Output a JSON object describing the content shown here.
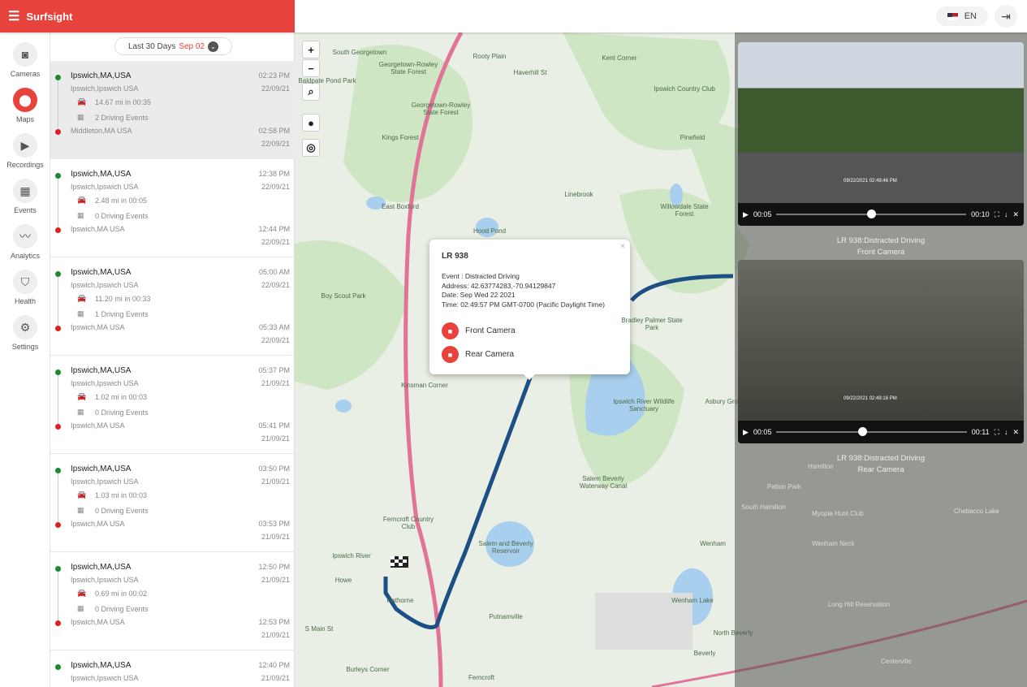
{
  "app": {
    "title": "Surfsight",
    "menu_icon": "menu-icon",
    "language": "EN",
    "logout_icon": "logout-icon"
  },
  "nav": [
    {
      "label": "Cameras",
      "icon": "camera-icon"
    },
    {
      "label": "Maps",
      "icon": "map-pin-icon",
      "active": true
    },
    {
      "label": "Recordings",
      "icon": "video-icon"
    },
    {
      "label": "Events",
      "icon": "calendar-icon"
    },
    {
      "label": "Analytics",
      "icon": "chart-line-icon"
    },
    {
      "label": "Health",
      "icon": "shield-icon"
    },
    {
      "label": "Settings",
      "icon": "gear-icon"
    }
  ],
  "filter": {
    "range": "Last 30 Days",
    "date": "Sep 02"
  },
  "trips": [
    {
      "from": "Ipswich,MA,USA",
      "from_sub": "Ipswich,Ipswich USA",
      "start_time": "02:23 PM",
      "start_date": "22/09/21",
      "distance": "14.67 mi in 00:35",
      "events": "2 Driving Events",
      "to": "Middleton,MA USA",
      "end_time": "02:58 PM",
      "end_date": "22/09/21"
    },
    {
      "from": "Ipswich,MA,USA",
      "from_sub": "Ipswich,Ipswich USA",
      "start_time": "12:38 PM",
      "start_date": "22/09/21",
      "distance": "2.48 mi in 00:05",
      "events": "0 Driving Events",
      "to": "Ipswich,MA USA",
      "end_time": "12:44 PM",
      "end_date": "22/09/21"
    },
    {
      "from": "Ipswich,MA,USA",
      "from_sub": "Ipswich,Ipswich USA",
      "start_time": "05:00 AM",
      "start_date": "22/09/21",
      "distance": "11.20 mi in 00:33",
      "events": "1 Driving Events",
      "to": "Ipswich,MA USA",
      "end_time": "05:33 AM",
      "end_date": "22/09/21"
    },
    {
      "from": "Ipswich,MA,USA",
      "from_sub": "Ipswich,Ipswich USA",
      "start_time": "05:37 PM",
      "start_date": "21/09/21",
      "distance": "1.02 mi in 00:03",
      "events": "0 Driving Events",
      "to": "Ipswich,MA USA",
      "end_time": "05:41 PM",
      "end_date": "21/09/21"
    },
    {
      "from": "Ipswich,MA,USA",
      "from_sub": "Ipswich,Ipswich USA",
      "start_time": "03:50 PM",
      "start_date": "21/09/21",
      "distance": "1.03 mi in 00:03",
      "events": "0 Driving Events",
      "to": "Ipswich,MA USA",
      "end_time": "03:53 PM",
      "end_date": "21/09/21"
    },
    {
      "from": "Ipswich,MA,USA",
      "from_sub": "Ipswich,Ipswich USA",
      "start_time": "12:50 PM",
      "start_date": "21/09/21",
      "distance": "0.69 mi in 00:02",
      "events": "0 Driving Events",
      "to": "Ipswich,MA USA",
      "end_time": "12:53 PM",
      "end_date": "21/09/21"
    },
    {
      "from": "Ipswich,MA,USA",
      "from_sub": "Ipswich,Ipswich USA",
      "start_time": "12:40 PM",
      "start_date": "21/09/21"
    }
  ],
  "map": {
    "zoom_in": "+",
    "zoom_out": "−",
    "labels": [
      "South Georgetown",
      "Georgetown-Rowley State Forest",
      "Rooty Plain",
      "Kent Corner",
      "Baldpate Pond Park",
      "Haverhill St",
      "Georgetown-Rowley State Forest",
      "Ipswich Country Club",
      "Kings Forest",
      "Pinefield",
      "Linebrook",
      "Willowdale State Forest",
      "East Boxford",
      "Hood Pond",
      "Boy Scout Park",
      "Bradley Palmer State Park",
      "Kinsman Corner",
      "Ipswich River Wildlife Sanctuary",
      "Salem Beverly Waterway Canal",
      "Asbury Grove",
      "Ferncroft Country Club",
      "Salem and Beverly Reservoir",
      "Wenham",
      "Ipswich River",
      "Howe",
      "Hathorne",
      "Putnamville",
      "Wenham Lake",
      "Burleys Corner",
      "Ferncroft",
      "Beverly",
      "North Beverly",
      "S Main St"
    ]
  },
  "popup": {
    "title": "LR 938",
    "event": "Event : Distracted Driving",
    "address": "Address: 42.63774283,-70.94129847",
    "date": "Date: Sep Wed 22 2021",
    "time": "Time: 02:49:57 PM GMT-0700 (Pacific Daylight Time)",
    "front": "Front Camera",
    "rear": "Rear Camera"
  },
  "videos": [
    {
      "current": "00:05",
      "duration": "00:10",
      "progress": 0.5,
      "caption": "LR 938:Distracted Driving",
      "camera": "Front Camera",
      "stamp": "09/22/2021 02:49:46 PM"
    },
    {
      "current": "00:05",
      "duration": "00:11",
      "progress": 0.45,
      "caption": "LR 938:Distracted Driving",
      "camera": "Rear Camera",
      "stamp": "09/22/2021 02:49:16 PM"
    }
  ],
  "overlay_labels": [
    "Hamilton",
    "Patton Park",
    "South Hamilton",
    "Myopia Hunt Club",
    "Chebacco Lake",
    "Wenham Neck",
    "Long Hill Reservation",
    "Centerville"
  ],
  "colors": {
    "accent": "#e8423c",
    "route": "#1d4f86",
    "highway": "#e27398",
    "start_dot": "#1a8a2a",
    "end_dot": "#e02020"
  }
}
